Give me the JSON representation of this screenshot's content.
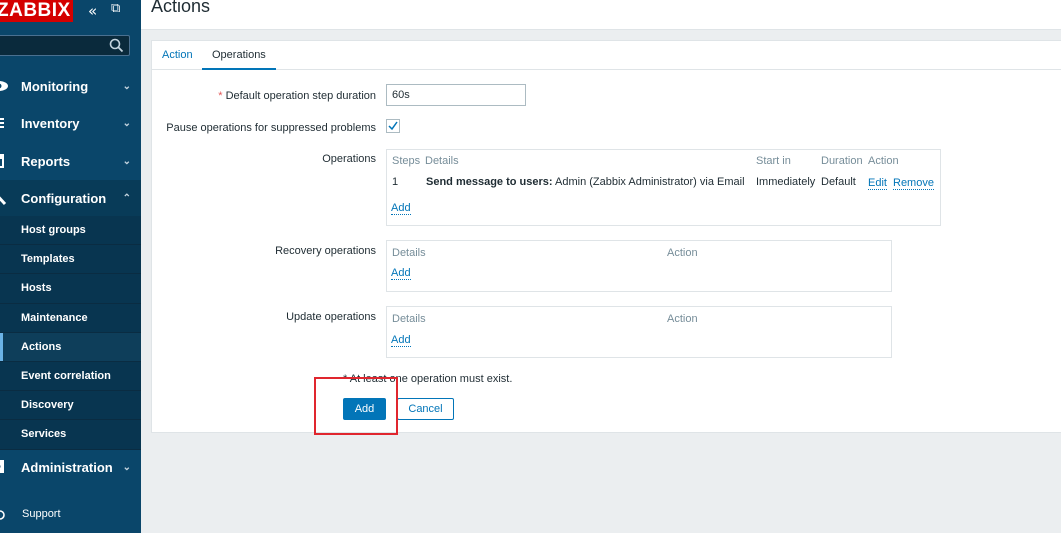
{
  "brand": "ZABBIX",
  "sidebar": {
    "menus": [
      {
        "label": "Monitoring",
        "icon": "eye-icon",
        "expanded": false
      },
      {
        "label": "Inventory",
        "icon": "list-icon",
        "expanded": false
      },
      {
        "label": "Reports",
        "icon": "report-icon",
        "expanded": false
      },
      {
        "label": "Configuration",
        "icon": "wrench-icon",
        "expanded": true
      },
      {
        "label": "Administration",
        "icon": "gear-icon",
        "expanded": false
      }
    ],
    "config_items": [
      "Host groups",
      "Templates",
      "Hosts",
      "Maintenance",
      "Actions",
      "Event correlation",
      "Discovery",
      "Services"
    ],
    "selected_item": "Actions",
    "support": "Support",
    "chevron_down": "⌄",
    "chevron_up": "⌃",
    "collapse_glyph": "«",
    "kiosk_glyph": "⧉"
  },
  "page": {
    "title": "Actions"
  },
  "tabs": [
    "Action",
    "Operations"
  ],
  "form": {
    "duration_label": "Default operation step duration",
    "required_mark": "*",
    "duration_value": "60s",
    "pause_label": "Pause operations for suppressed problems",
    "pause_checked": true,
    "operations_label": "Operations",
    "operations_headers": [
      "Steps",
      "Details",
      "Start in",
      "Duration",
      "Action"
    ],
    "operations_row": {
      "step": "1",
      "details_bold": "Send message to users:",
      "details_rest": " Admin (Zabbix Administrator) via Email",
      "start_in": "Immediately",
      "duration": "Default",
      "edit": "Edit",
      "remove": "Remove"
    },
    "add_link": "Add",
    "recovery_label": "Recovery operations",
    "update_label": "Update operations",
    "sub_headers": [
      "Details",
      "Action"
    ],
    "note": "* At least one operation must exist.",
    "add_button": "Add",
    "cancel_button": "Cancel"
  },
  "colors": {
    "sidebar": "#0a466a",
    "accent": "#0275b8",
    "brand_red": "#d40000",
    "highlight": "#e0262e"
  }
}
